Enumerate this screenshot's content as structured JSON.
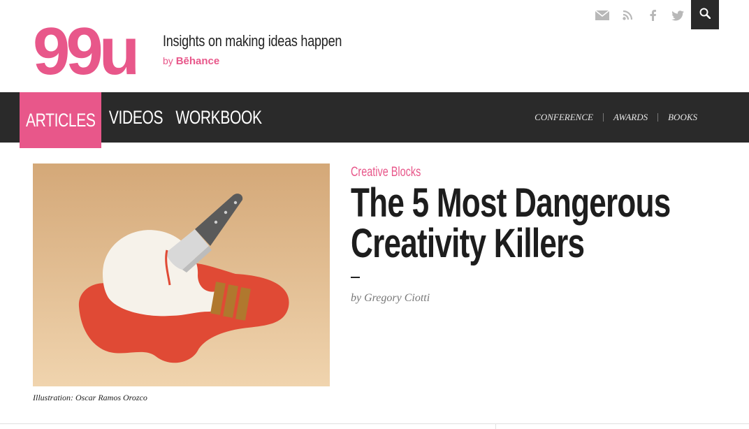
{
  "brand": {
    "logo_text": "99u",
    "tagline": "Insights on making ideas happen",
    "by": "by",
    "partner": "Bēhance",
    "accent_color": "#e8578a",
    "dark_color": "#2a2a2a"
  },
  "social": {
    "icons": [
      "mail-icon",
      "rss-icon",
      "facebook-icon",
      "twitter-icon"
    ],
    "search_icon": "search-icon"
  },
  "nav": {
    "main": [
      {
        "label": "ARTICLES",
        "active": true
      },
      {
        "label": "VIDEOS",
        "active": false
      },
      {
        "label": "WORKBOOK",
        "active": false
      }
    ],
    "secondary": [
      "CONFERENCE",
      "AWARDS",
      "BOOKS"
    ]
  },
  "article": {
    "category": "Creative Blocks",
    "title": "The 5 Most Dangerous Creativity Killers",
    "author": "by Gregory Ciotti",
    "image_credit": "Illustration: Oscar Ramos Orozco"
  }
}
